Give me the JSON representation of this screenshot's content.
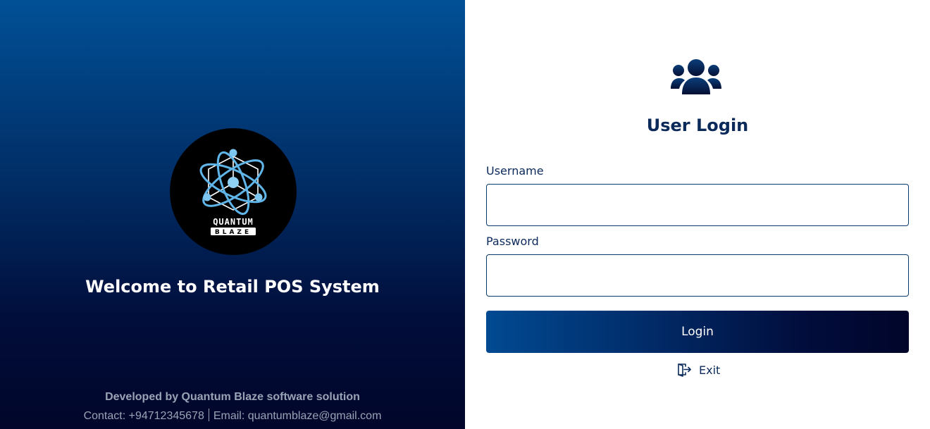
{
  "branding": {
    "logo_text_top": "QUANTUM",
    "logo_text_bottom": "BLAZE",
    "welcome": "Welcome to Retail POS System",
    "developed_by": "Developed by Quantum Blaze software solution",
    "contact": "Contact: +94712345678",
    "email": "Email: quantumblaze@gmail.com"
  },
  "login": {
    "title": "User Login",
    "username_label": "Username",
    "username_value": "",
    "password_label": "Password",
    "password_value": "",
    "login_button": "Login",
    "exit_label": "Exit"
  },
  "icons": {
    "users": "users-group-icon",
    "exit": "exit-door-icon"
  },
  "colors": {
    "primary_dark": "#0b2a5a",
    "gradient_start": "#015096",
    "gradient_end": "#01062a",
    "footer_text": "#9aa3b5"
  }
}
